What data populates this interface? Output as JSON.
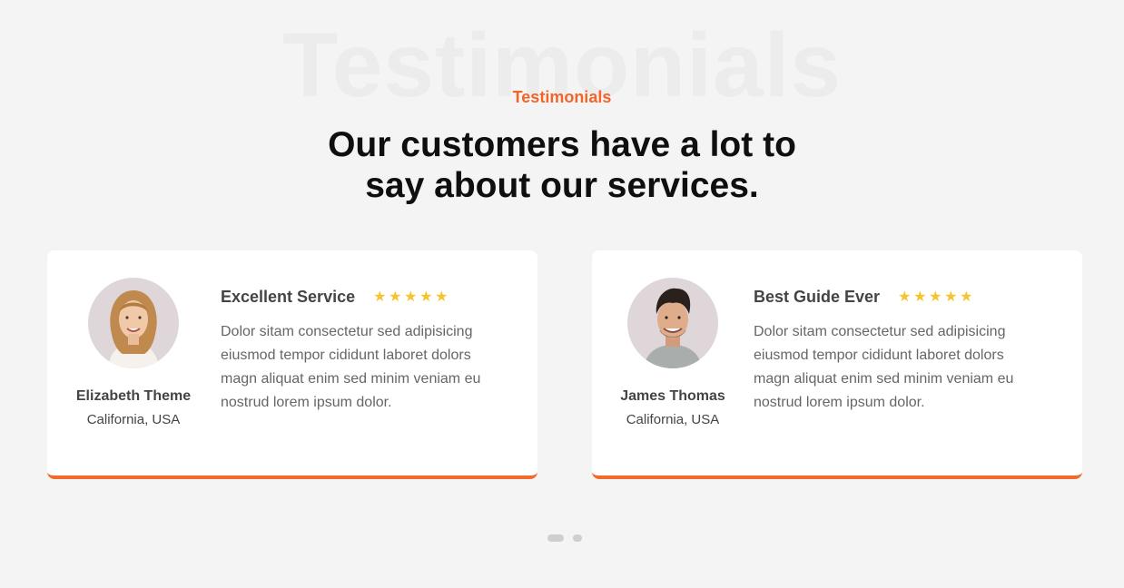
{
  "section": {
    "background_word": "Testimonials",
    "eyebrow": "Testimonials",
    "title_line1": "Our customers have a lot to",
    "title_line2": "say about our services."
  },
  "testimonials": [
    {
      "name": "Elizabeth Theme",
      "location": "California, USA",
      "review_title": "Excellent Service",
      "rating": 5,
      "text": "Dolor sitam consectetur sed adipisicing eiusmod tempor cididunt laboret dolors magn aliquat enim sed minim veniam eu nostrud lorem ipsum dolor.",
      "avatar_icon": "woman-portrait"
    },
    {
      "name": "James Thomas",
      "location": "California, USA",
      "review_title": "Best Guide Ever",
      "rating": 5,
      "text": "Dolor sitam consectetur sed adipisicing eiusmod tempor cididunt laboret dolors magn aliquat enim sed minim veniam eu nostrud lorem ipsum dolor.",
      "avatar_icon": "man-portrait"
    }
  ],
  "colors": {
    "accent": "#f2652a",
    "star": "#f7c32e",
    "background": "#f4f4f4"
  },
  "carousel": {
    "slides": 2,
    "active_index": 0
  }
}
